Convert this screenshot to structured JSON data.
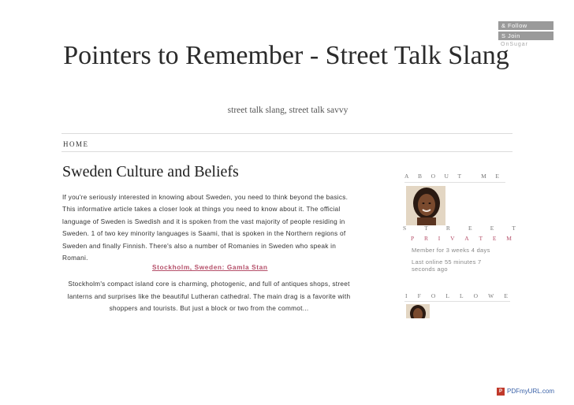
{
  "follow_box": {
    "follow_label": "Follow",
    "join_label": "Join",
    "brand": "OnSugar",
    "follow_icon": "ampersand-icon",
    "join_icon": "sugar-s-icon"
  },
  "header": {
    "title": "Pointers to Remember - Street Talk Slang",
    "tagline": "street talk slang, street talk savvy"
  },
  "nav": {
    "home_label": "HOME"
  },
  "post": {
    "title": "Sweden Culture and Beliefs",
    "paragraph": "If you're seriously interested in knowing about Sweden, you need to think beyond the basics. This informative article takes a closer look at things you need to know about it. The official language of Sweden is Swedish and it is spoken from the vast majority of people residing in Sweden. 1 of two key minority languages is Saami, that is spoken in the Northern regions of Sweden and finally Finnish. There's also a number of Romanies in Sweden who speak in Romani.",
    "sub_link": "Stockholm, Sweden: Gamla Stan",
    "excerpt": "Stockholm's compact island core is charming, photogenic, and full of antiques shops, street lanterns and surprises like the beautiful Lutheran cathedral. The main drag is a favorite with shoppers and tourists. But just a block or two from the commot..."
  },
  "sidebar": {
    "about_heading": [
      "A",
      "B",
      "O",
      "U",
      "T",
      "",
      "M",
      "E"
    ],
    "user_name_line1": [
      "S",
      "T",
      "R",
      "E",
      "E",
      "T"
    ],
    "user_name_line2": [
      "P",
      "R",
      "I",
      "V",
      "A",
      "T",
      "E",
      "M"
    ],
    "member_for": "Member for 3 weeks 4 days",
    "last_online": "Last online 55 minutes 7 seconds ago",
    "follow_heading": [
      "I",
      "F",
      "O",
      "L",
      "L",
      "O",
      "W",
      "E"
    ]
  },
  "footer": {
    "pdf_badge": "PDFmyURL.com"
  },
  "colors": {
    "accent": "#b5506a",
    "link_blue": "#3a62a8",
    "button_gray": "#9a9a9a"
  }
}
